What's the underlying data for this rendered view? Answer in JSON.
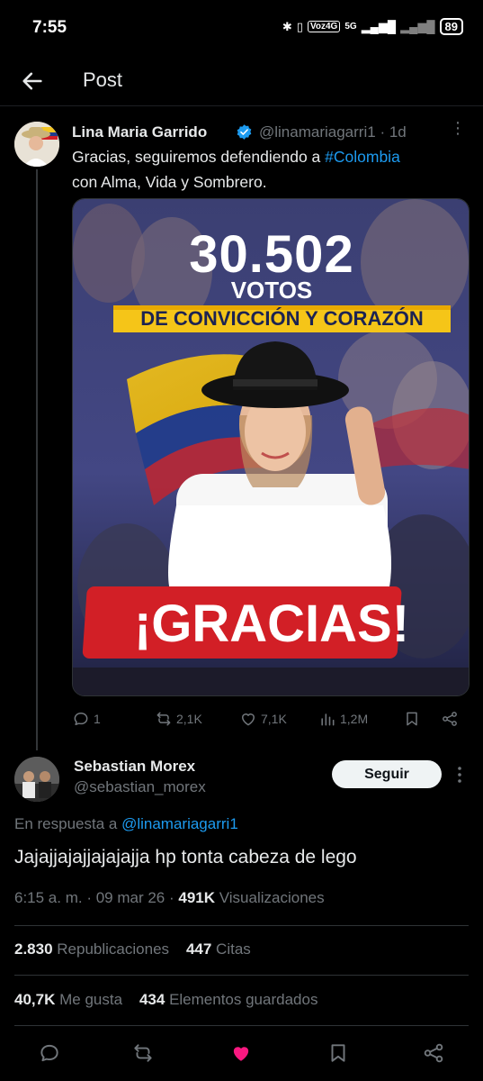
{
  "status_bar": {
    "time": "7:55",
    "network_label": "Voz4G",
    "network_type": "5G",
    "battery": "89"
  },
  "header": {
    "title": "Post"
  },
  "parent_tweet": {
    "author_name": "Lina Maria Garrido",
    "author_handle": "@linamariagarri1",
    "age": "· 1d",
    "text_before": "Gracias, seguiremos defendiendo a ",
    "hashtag": "#Colombia",
    "text_after": "con Alma, Vida y Sombrero.",
    "media": {
      "headline_number": "30.502",
      "headline_votes": "VOTOS",
      "banner": "DE CONVICCIÓN Y CORAZÓN",
      "footer": "¡GRACIAS!"
    },
    "actions": {
      "replies": "1",
      "reposts": "2,1K",
      "likes": "7,1K",
      "views": "1,2M"
    }
  },
  "reply_tweet": {
    "author_name": "Sebastian Morex",
    "author_handle": "@sebastian_morex",
    "follow_label": "Seguir",
    "reply_prefix": "En respuesta a ",
    "reply_to": "@linamariagarri1",
    "text": "Jajajjajajjajajajja hp tonta cabeza de lego",
    "time": "6:15 a. m.",
    "date": "09 mar 26",
    "views_count": "491K",
    "views_label": "Visualizaciones",
    "reposts_count": "2.830",
    "reposts_label": "Republicaciones",
    "quotes_count": "447",
    "quotes_label": "Citas",
    "likes_count": "40,7K",
    "likes_label": "Me gusta",
    "bookmarks_count": "434",
    "bookmarks_label": "Elementos guardados"
  },
  "colors": {
    "accent": "#1d9bf0",
    "like_active": "#f91880",
    "muted": "#71767b"
  },
  "bottom_bar": {
    "icons": [
      "reply-icon",
      "repost-icon",
      "like-icon-active",
      "bookmark-icon",
      "share-icon"
    ]
  }
}
